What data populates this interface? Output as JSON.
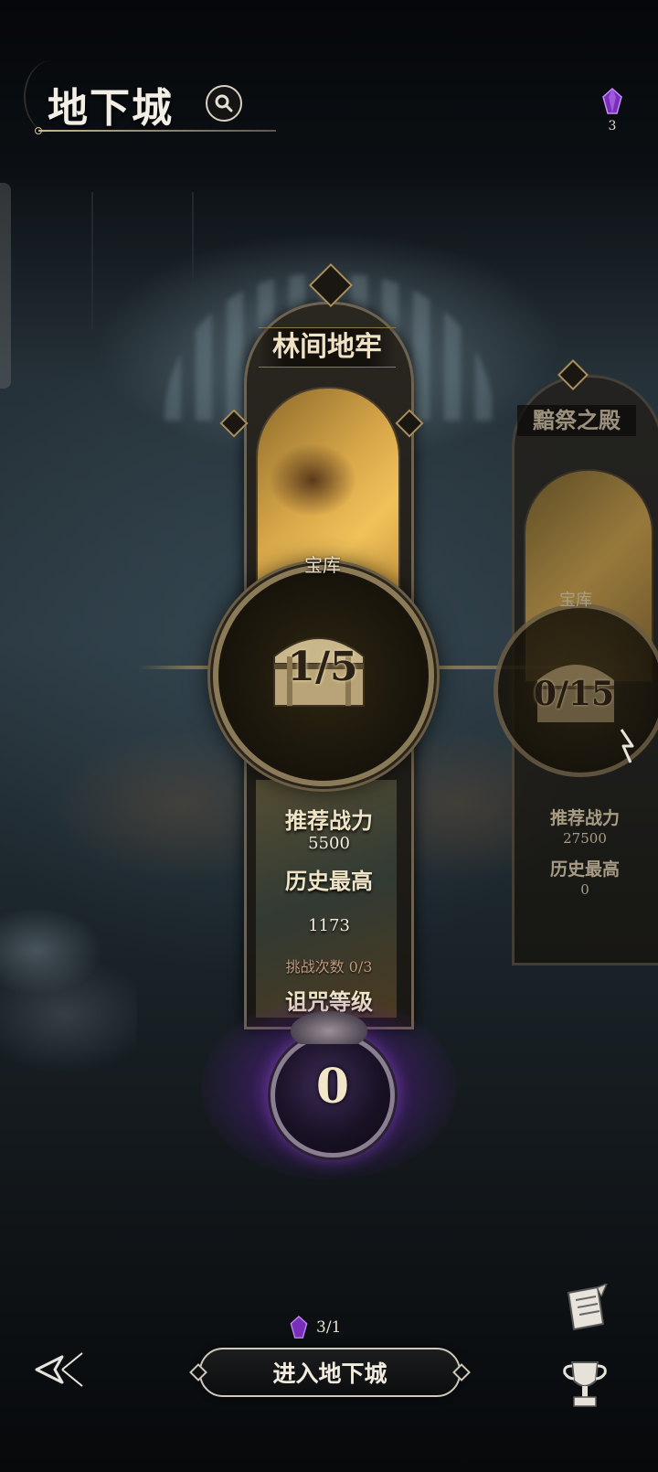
{
  "header": {
    "title": "地下城",
    "search_icon": "search-icon"
  },
  "currency": {
    "icon": "purple-gem-icon",
    "count": "3",
    "color": "#9b4fd6"
  },
  "dungeons": [
    {
      "name": "林间地牢",
      "vault_label": "宝库",
      "vault_progress": "1/5",
      "recommended_power_label": "推荐战力",
      "recommended_power": "5500",
      "best_label": "历史最高",
      "best": "1173",
      "challenges": "挑战次数 0/3",
      "curse_label": "诅咒等级",
      "curse_level": "0"
    },
    {
      "name": "黯祭之殿",
      "vault_label": "宝库",
      "vault_progress": "0/15",
      "recommended_power_label": "推荐战力",
      "recommended_power": "27500",
      "best_label": "历史最高",
      "best": "0"
    }
  ],
  "footer": {
    "cost": "3/1",
    "enter_button": "进入地下城",
    "icons": [
      "back-icon",
      "scroll-icon",
      "trophy-icon",
      "next-arrow-icon"
    ]
  },
  "colors": {
    "gold": "#d9a84a",
    "curse_purple": "#963cdc",
    "text_cream": "#f0e4c6"
  }
}
